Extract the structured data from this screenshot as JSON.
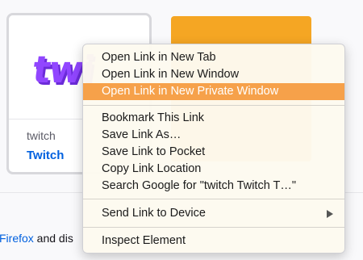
{
  "tiles": [
    {
      "logo": "twi",
      "host": "twitch",
      "title": "Twitch"
    }
  ],
  "footer": {
    "link": "Firefox",
    "text": " and dis"
  },
  "context_menu": {
    "items": [
      {
        "label": "Open Link in New Tab"
      },
      {
        "label": "Open Link in New Window"
      },
      {
        "label": "Open Link in New Private Window",
        "highlighted": true
      },
      {
        "label": "Bookmark This Link"
      },
      {
        "label": "Save Link As…"
      },
      {
        "label": "Save Link to Pocket"
      },
      {
        "label": "Copy Link Location"
      },
      {
        "label": "Search Google for \"twitch Twitch T…\""
      },
      {
        "label": "Send Link to Device",
        "submenu": true
      },
      {
        "label": "Inspect Element"
      }
    ],
    "highlight_color": "#f6a14a",
    "submenu_icon": "chevron-right-icon"
  }
}
